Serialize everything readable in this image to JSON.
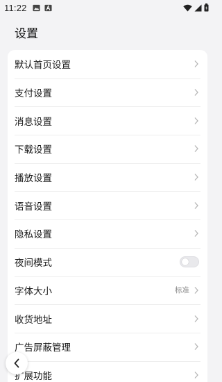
{
  "status_bar": {
    "time": "11:22",
    "left_icons": [
      "image-icon",
      "font-app-icon"
    ],
    "right_icons": [
      "wifi-icon",
      "signal-icon",
      "battery-icon"
    ]
  },
  "page": {
    "title": "设置"
  },
  "settings": {
    "items": [
      {
        "label": "默认首页设置",
        "type": "link"
      },
      {
        "label": "支付设置",
        "type": "link"
      },
      {
        "label": "消息设置",
        "type": "link"
      },
      {
        "label": "下载设置",
        "type": "link"
      },
      {
        "label": "播放设置",
        "type": "link"
      },
      {
        "label": "语音设置",
        "type": "link"
      },
      {
        "label": "隐私设置",
        "type": "link"
      },
      {
        "label": "夜间模式",
        "type": "toggle",
        "enabled": false
      },
      {
        "label": "字体大小",
        "type": "link",
        "value": "标准"
      },
      {
        "label": "收货地址",
        "type": "link"
      },
      {
        "label": "广告屏蔽管理",
        "type": "link"
      },
      {
        "label": "扩展功能",
        "type": "link"
      }
    ]
  },
  "colors": {
    "background": "#f3f3f5",
    "card": "#ffffff",
    "chevron": "#b5b5b5",
    "secondary_text": "#8a8a8a"
  }
}
